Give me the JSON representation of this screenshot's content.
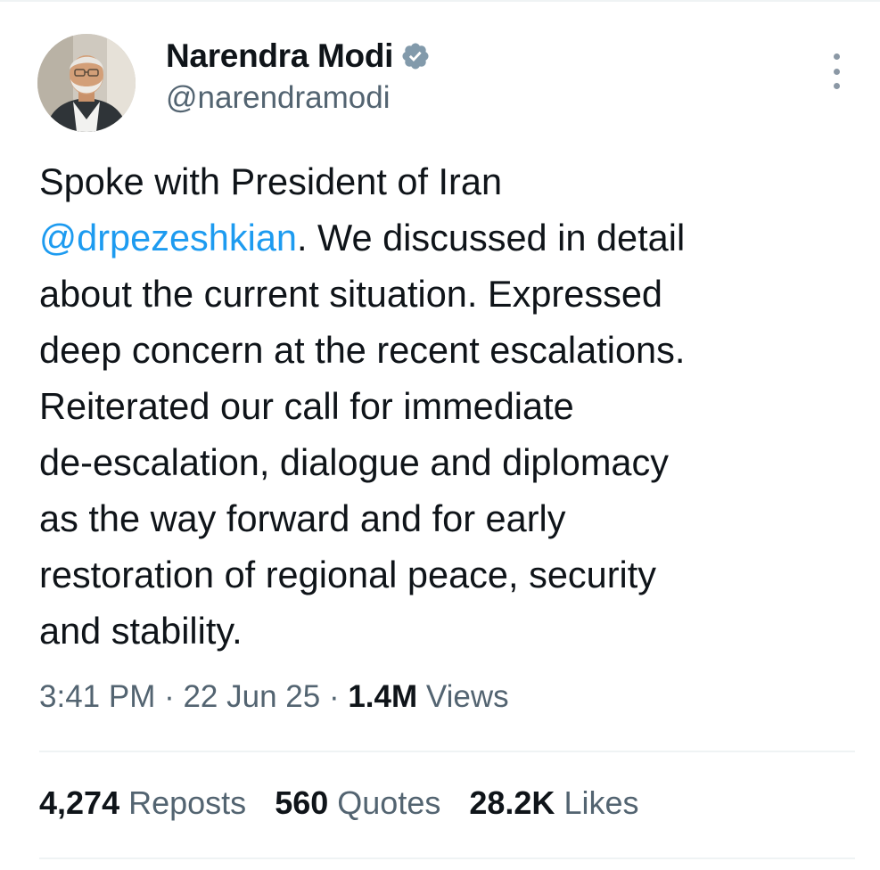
{
  "author": {
    "display_name": "Narendra Modi",
    "handle": "@narendramodi",
    "verified": true,
    "verified_color": "#829aab"
  },
  "tweet": {
    "lines": [
      [
        "",
        "Spoke with President of Iran",
        ""
      ],
      [
        "@drpezeshkian",
        ". We discussed in detail",
        ""
      ],
      [
        "",
        "about the current situation. Expressed",
        ""
      ],
      [
        "",
        "deep concern at the recent escalations.",
        ""
      ],
      [
        "",
        "Reiterated our call for immediate",
        ""
      ],
      [
        "",
        "de-escalation, dialogue and diplomacy",
        ""
      ],
      [
        "",
        "as the way forward and for early",
        ""
      ],
      [
        "",
        "restoration of regional peace, security",
        ""
      ],
      [
        "",
        "and stability.",
        ""
      ]
    ]
  },
  "meta": {
    "time": "3:41 PM",
    "sep1": " · ",
    "date": "22 Jun 25",
    "sep2": " · ",
    "views_count": "1.4M",
    "views_label": " Views"
  },
  "stats": {
    "reposts_count": "4,274",
    "reposts_label": "Reposts",
    "quotes_count": "560",
    "quotes_label": "Quotes",
    "likes_count": "28.2K",
    "likes_label": "Likes"
  },
  "colors": {
    "text": "#0f1419",
    "secondary": "#536471",
    "link": "#1d9bf0",
    "divider": "#eff3f4"
  },
  "icons": {
    "verified": "verified-badge-icon",
    "more": "more-options-icon"
  }
}
